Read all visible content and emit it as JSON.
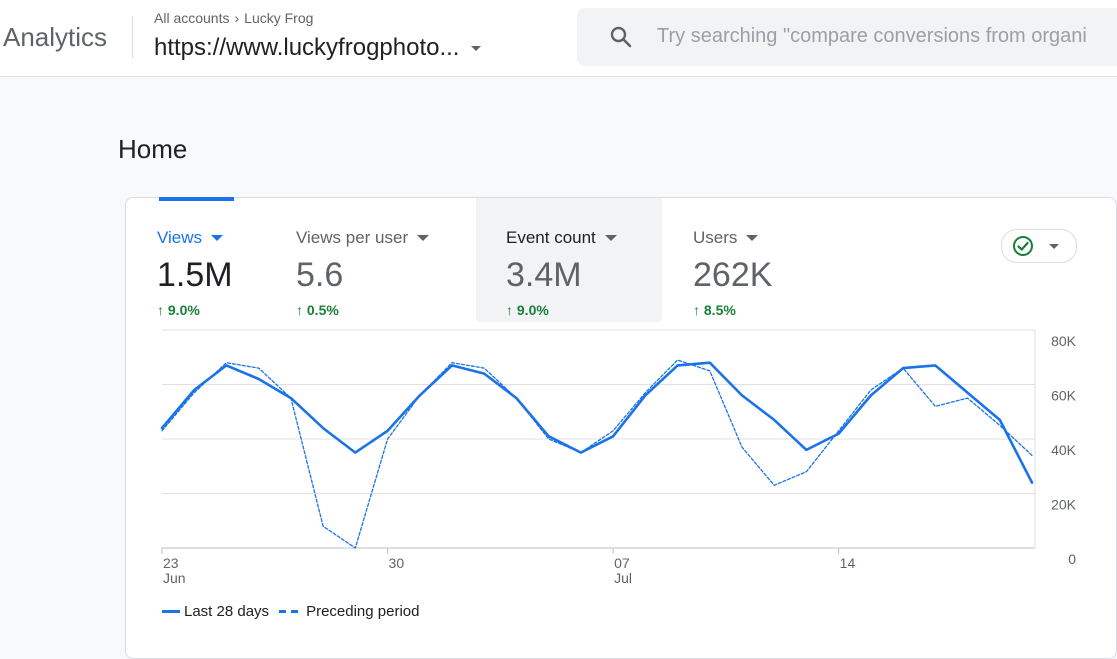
{
  "header": {
    "app_title": "Analytics",
    "breadcrumb": {
      "account": "All accounts",
      "property": "Lucky Frog"
    },
    "property_url": "https://www.luckyfrogphoto...",
    "search_placeholder": "Try searching \"compare conversions from organi"
  },
  "page": {
    "title": "Home"
  },
  "metrics": [
    {
      "label": "Views",
      "value": "1.5M",
      "delta": "9.0%",
      "selected": true
    },
    {
      "label": "Views per user",
      "value": "5.6",
      "delta": "0.5%"
    },
    {
      "label": "Event count",
      "value": "3.4M",
      "delta": "9.0%"
    },
    {
      "label": "Users",
      "value": "262K",
      "delta": "8.5%"
    }
  ],
  "icons": {
    "search": "search-icon",
    "status": "check-circle-icon",
    "up_arrow": "arrow-up-icon"
  },
  "colors": {
    "accent": "#1a73e8",
    "positive": "#188038",
    "status_green": "#188038"
  },
  "chart_data": {
    "type": "line",
    "y_ticks": [
      "80K",
      "60K",
      "40K",
      "20K",
      "0"
    ],
    "ylim": [
      0,
      80000
    ],
    "x_ticks": [
      {
        "day": "23",
        "month": "Jun",
        "index": 0
      },
      {
        "day": "30",
        "month": "",
        "index": 7
      },
      {
        "day": "07",
        "month": "Jul",
        "index": 14
      },
      {
        "day": "14",
        "month": "",
        "index": 21
      }
    ],
    "grid": true,
    "legend_position": "bottom-left",
    "series": [
      {
        "name": "Last 28 days",
        "style": "solid",
        "values": [
          44000,
          58000,
          67000,
          62000,
          55000,
          44000,
          35000,
          43000,
          56000,
          67000,
          64000,
          55000,
          41000,
          35000,
          41000,
          56000,
          67000,
          68000,
          56000,
          47000,
          36000,
          42000,
          56000,
          66000,
          67000,
          57000,
          47000,
          24000
        ]
      },
      {
        "name": "Preceding period",
        "style": "dashed",
        "values": [
          43000,
          57000,
          68000,
          66000,
          55000,
          8000,
          0,
          40000,
          56000,
          68000,
          66000,
          55000,
          40000,
          35000,
          43000,
          57000,
          69000,
          65000,
          37000,
          23000,
          28000,
          43000,
          58000,
          66000,
          52000,
          55000,
          45000,
          34000
        ]
      }
    ]
  }
}
